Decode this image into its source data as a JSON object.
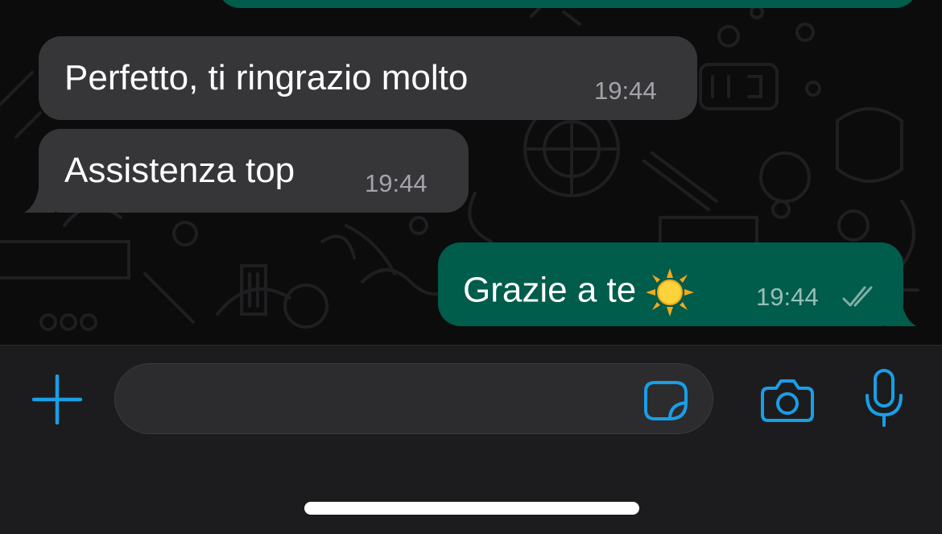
{
  "messages": [
    {
      "direction": "incoming",
      "text": "Perfetto, ti ringrazio molto",
      "time": "19:44"
    },
    {
      "direction": "incoming",
      "text": "Assistenza top",
      "time": "19:44"
    },
    {
      "direction": "outgoing",
      "text": "Grazie a te",
      "emoji": "sun",
      "time": "19:44",
      "status": "read-double-check"
    }
  ],
  "input_bar": {
    "add_icon": "plus-icon",
    "message_placeholder": "",
    "sticker_icon": "sticker-icon",
    "camera_icon": "camera-icon",
    "mic_icon": "microphone-icon"
  },
  "colors": {
    "incoming_bubble": "#363638",
    "outgoing_bubble": "#005c4b",
    "accent": "#1a9ee6",
    "background": "#0c0c0c"
  }
}
